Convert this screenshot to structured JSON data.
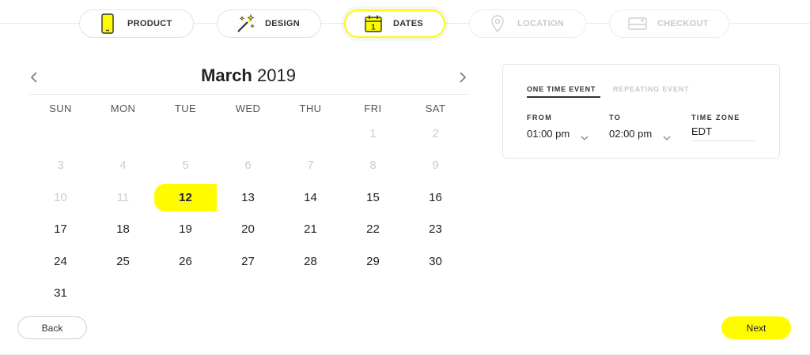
{
  "stepper": {
    "steps": [
      {
        "label": "PRODUCT",
        "icon": "phone-icon",
        "state": "done"
      },
      {
        "label": "DESIGN",
        "icon": "magic-wand-icon",
        "state": "done"
      },
      {
        "label": "DATES",
        "icon": "calendar-icon",
        "state": "active"
      },
      {
        "label": "LOCATION",
        "icon": "location-pin-icon",
        "state": "disabled"
      },
      {
        "label": "CHECKOUT",
        "icon": "credit-card-icon",
        "state": "disabled"
      }
    ]
  },
  "calendar": {
    "month": "March",
    "year": "2019",
    "weekdays": [
      "SUN",
      "MON",
      "TUE",
      "WED",
      "THU",
      "FRI",
      "SAT"
    ],
    "days": [
      "",
      "",
      "",
      "",
      "",
      "1",
      "2",
      "3",
      "4",
      "5",
      "6",
      "7",
      "8",
      "9",
      "10",
      "11",
      "12",
      "13",
      "14",
      "15",
      "16",
      "17",
      "18",
      "19",
      "20",
      "21",
      "22",
      "23",
      "24",
      "25",
      "26",
      "27",
      "28",
      "29",
      "30",
      "31"
    ],
    "first_available_day": 12,
    "selected_day": 12
  },
  "event": {
    "tabs": {
      "one_time": "ONE TIME EVENT",
      "repeating": "REPEATING EVENT"
    },
    "from_label": "FROM",
    "from_value": "01:00 pm",
    "to_label": "TO",
    "to_value": "02:00 pm",
    "timezone_label": "TIME ZONE",
    "timezone_value": "EDT"
  },
  "buttons": {
    "back": "Back",
    "next": "Next"
  },
  "colors": {
    "accent": "#fffc00",
    "muted": "#cdcdcd"
  }
}
